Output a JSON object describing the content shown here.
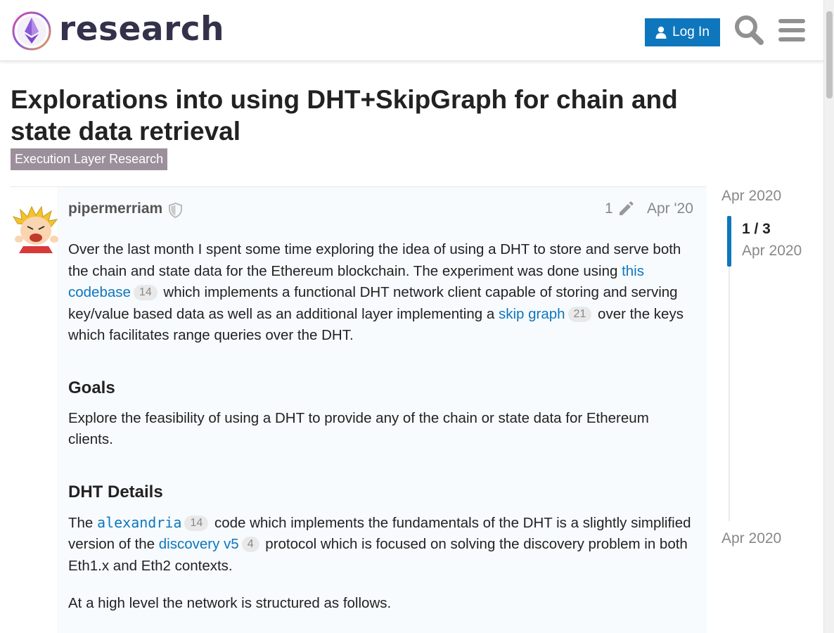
{
  "header": {
    "site_name": "research",
    "login_label": "Log In",
    "icons": {
      "logo": "ethereum-research-logo",
      "user": "user-icon",
      "search": "search-icon",
      "menu": "hamburger-menu-icon"
    }
  },
  "topic": {
    "title": "Explorations into using DHT+SkipGraph for chain and state data retrieval",
    "category": "Execution Layer Research",
    "category_color": "#9c8f9c"
  },
  "post": {
    "username": "pipermerriam",
    "edit_count": "1",
    "date": "Apr '20",
    "p1": {
      "t1": "Over the last month I spent some time exploring the idea of using a DHT to store and serve both the chain and state data for the Ethereum blockchain. The experiment was done using ",
      "link1": "this codebase",
      "link1_clicks": "14",
      "t2": " which implements a functional DHT network client capable of storing and serving key/value based data as well as an additional layer implementing a ",
      "link2": "skip graph",
      "link2_clicks": "21",
      "t3": " over the keys which facilitates range queries over the DHT."
    },
    "h_goals": "Goals",
    "goals_text": "Explore the feasibility of using a DHT to provide any of the chain or state data for Ethereum clients.",
    "h_dht": "DHT Details",
    "p_dht": {
      "t1": "The ",
      "code_link": "alexandria",
      "code_link_clicks": "14",
      "t2": " code which implements the fundamentals of the DHT is a slightly simplified version of the ",
      "link": "discovery v5",
      "link_clicks": "4",
      "t3": " protocol which is focused on solving the discovery problem in both Eth1.x and Eth2 contexts."
    },
    "p_last": "At a high level the network is structured as follows."
  },
  "timeline": {
    "start_date": "Apr 2020",
    "progress": "1 / 3",
    "progress_date": "Apr 2020",
    "end_date": "Apr 2020"
  },
  "colors": {
    "accent": "#0e76bd",
    "post_bg": "#f7fbfd",
    "muted": "#888888"
  }
}
